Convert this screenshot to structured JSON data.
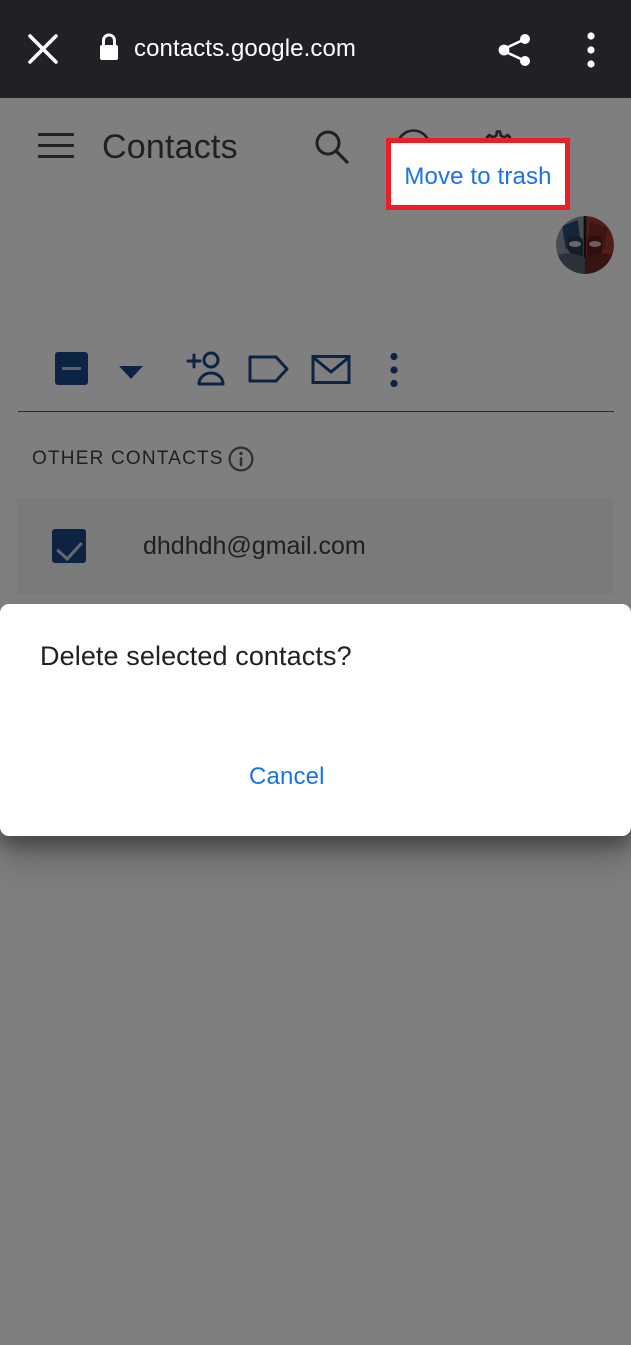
{
  "browser_bar": {
    "close_icon": "close-icon",
    "lock_icon": "lock-icon",
    "url": "contacts.google.com",
    "share_icon": "share-icon",
    "menu_icon": "more-vert-icon",
    "background_color": "#202124",
    "text_color": "#ffffff"
  },
  "app_header": {
    "menu_icon": "hamburger-icon",
    "title": "Contacts",
    "search_icon": "search-icon",
    "help_icon": "help-circle-icon",
    "settings_icon": "gear-icon",
    "avatar_icon": "user-avatar",
    "text_color": "#3c4043"
  },
  "toolbar": {
    "select_all_checkbox": {
      "icon": "checkbox-indeterminate-icon",
      "state": "indeterminate",
      "color": "#1a4789"
    },
    "select_dropdown_icon": "chevron-down-icon",
    "add_person_icon": "person-add-icon",
    "label_icon": "label-tag-icon",
    "email_icon": "envelope-icon",
    "more_options_icon": "more-vert-icon",
    "accent_color": "#1a4789"
  },
  "contacts_section": {
    "label": "OTHER CONTACTS",
    "info_icon": "info-circle-icon",
    "rows": [
      {
        "email": "dhdhdh@gmail.com",
        "checkbox_icon": "checkbox-checked-icon",
        "selected": true
      }
    ]
  },
  "dialog": {
    "title": "Delete selected contacts?",
    "cancel_label": "Cancel",
    "confirm_label": "Move to trash",
    "link_color": "#1a73e8",
    "title_color": "#202124",
    "background_color": "#ffffff"
  },
  "highlight": {
    "target": "Move to trash",
    "border_color": "#ee1c25",
    "border_width_px": 5
  },
  "scrim": {
    "color": "#000000",
    "opacity": 0.5
  }
}
